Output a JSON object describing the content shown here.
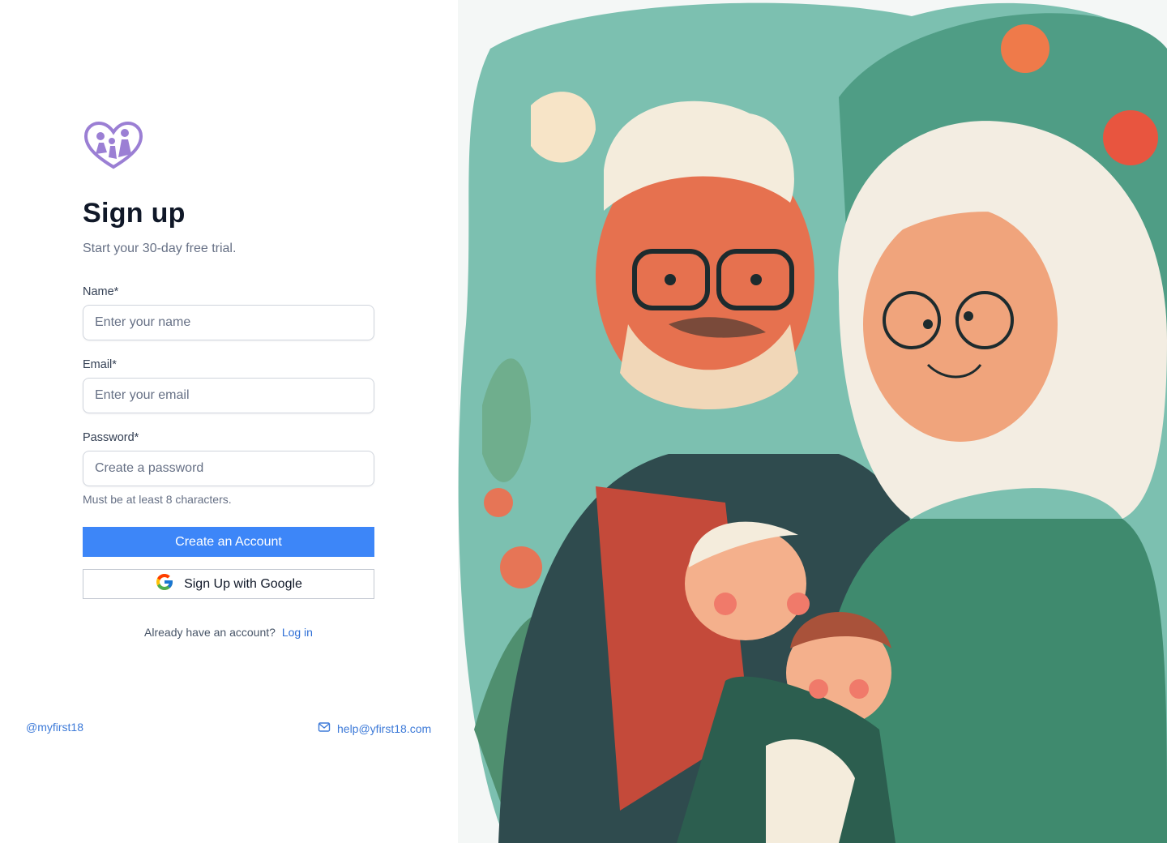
{
  "header": {
    "title": "Sign up",
    "subtitle": "Start your 30-day free trial."
  },
  "form": {
    "name_label": "Name*",
    "name_placeholder": "Enter your name",
    "email_label": "Email*",
    "email_placeholder": "Enter your email",
    "password_label": "Password*",
    "password_placeholder": "Create a password",
    "password_hint": "Must be at least 8 characters.",
    "create_button": "Create an Account",
    "google_button": "Sign Up with Google"
  },
  "login": {
    "prompt": "Already have an account?",
    "link_label": "Log in"
  },
  "footer": {
    "handle": "@myfirst18",
    "email": "help@yfirst18.com"
  },
  "icons": {
    "logo": "family-heart-logo",
    "google": "google-g-icon",
    "email": "mail-icon"
  },
  "colors": {
    "primary": "#3d86f8",
    "link": "#3d7ad8",
    "logo": "#9b7fd4",
    "heading": "#101828",
    "muted": "#667085"
  }
}
